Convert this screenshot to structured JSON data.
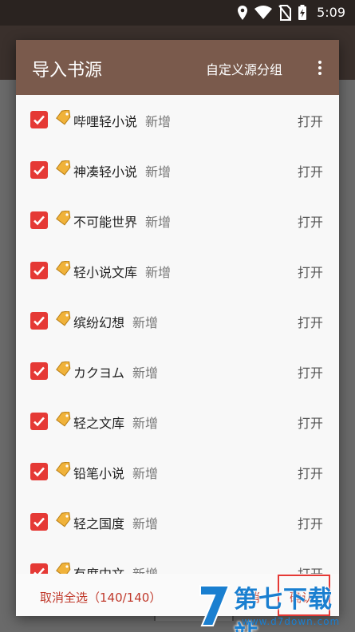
{
  "status_bar": {
    "time": "5:09"
  },
  "dialog": {
    "title": "导入书源",
    "custom_group": "自定义源分组",
    "more_icon": "more-vertical-icon"
  },
  "rows": [
    {
      "name": "哔哩轻小说",
      "badge": "新增",
      "action": "打开",
      "checked": true
    },
    {
      "name": "神凑轻小说",
      "badge": "新增",
      "action": "打开",
      "checked": true
    },
    {
      "name": "不可能世界",
      "badge": "新增",
      "action": "打开",
      "checked": true
    },
    {
      "name": "轻小说文库",
      "badge": "新增",
      "action": "打开",
      "checked": true
    },
    {
      "name": "缤纷幻想",
      "badge": "新增",
      "action": "打开",
      "checked": true
    },
    {
      "name": "カクヨム",
      "badge": "新增",
      "action": "打开",
      "checked": true
    },
    {
      "name": "轻之文库",
      "badge": "新增",
      "action": "打开",
      "checked": true
    },
    {
      "name": "铅笔小说",
      "badge": "新增",
      "action": "打开",
      "checked": true
    },
    {
      "name": "轻之国度",
      "badge": "新增",
      "action": "打开",
      "checked": true
    },
    {
      "name": "有度中文",
      "badge": "新增",
      "action": "打开",
      "checked": true
    }
  ],
  "footer": {
    "deselect_all": "取消全选（140/140）",
    "cancel": "取消",
    "confirm": "确认"
  },
  "watermark": {
    "cn": "第七下载站",
    "en": "www.d7down.com"
  },
  "colors": {
    "header": "#7a5a4c",
    "accent": "#e53935",
    "status_bar": "#2a2320"
  }
}
